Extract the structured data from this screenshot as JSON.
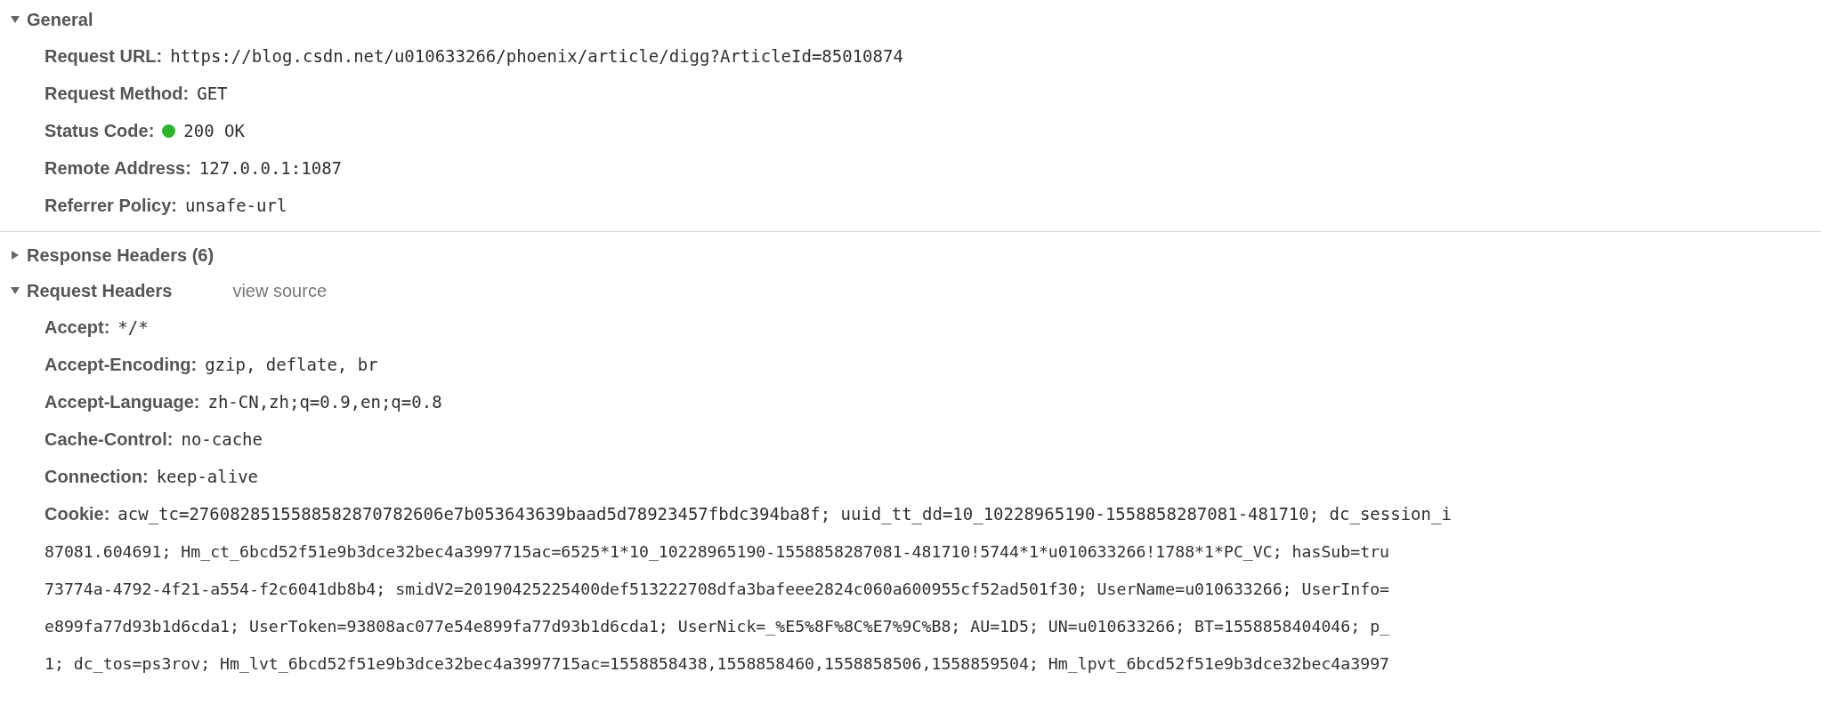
{
  "sections": [
    {
      "title": "General",
      "expanded": true,
      "rows": [
        {
          "name": "Request URL:",
          "value": "https://blog.csdn.net/u010633266/phoenix/article/digg?ArticleId=85010874"
        },
        {
          "name": "Request Method:",
          "value": "GET"
        },
        {
          "name": "Status Code:",
          "value": "200 OK",
          "color": "#2bb52b"
        },
        {
          "name": "Remote Address:",
          "value": "127.0.0.1:1087"
        },
        {
          "name": "Referrer Policy:",
          "value": "unsafe-url"
        }
      ]
    },
    {
      "title": "Response Headers (6)",
      "expanded": false
    },
    {
      "title": "Request Headers",
      "expanded": true,
      "link": "view source",
      "rows": [
        {
          "name": "Accept:",
          "value": "*/*"
        },
        {
          "name": "Accept-Encoding:",
          "value": "gzip, deflate, br"
        },
        {
          "name": "Accept-Language:",
          "value": "zh-CN,zh;q=0.9,en;q=0.8"
        },
        {
          "name": "Cache-Control:",
          "value": "no-cache"
        },
        {
          "name": "Connection:",
          "value": "keep-alive"
        },
        {
          "name": "Cookie:",
          "value": "acw_tc=2760828515588582870782606e7b053643639baad5d78923457fbdc394ba8f; uuid_tt_dd=10_10228965190-1558858287081-481710; dc_session_i",
          "more": [
            "87081.604691; Hm_ct_6bcd52f51e9b3dce32bec4a3997715ac=6525*1*10_10228965190-1558858287081-481710!5744*1*u010633266!1788*1*PC_VC; hasSub=tru",
            "73774a-4792-4f21-a554-f2c6041db8b4; smidV2=20190425225400def513222708dfa3bafeee2824c060a600955cf52ad501f30; UserName=u010633266; UserInfo=",
            "e899fa77d93b1d6cda1; UserToken=93808ac077e54e899fa77d93b1d6cda1; UserNick=_%E5%8F%8C%E7%9C%B8; AU=1D5; UN=u010633266; BT=1558858404046; p_",
            "1; dc_tos=ps3rov; Hm_lvt_6bcd52f51e9b3dce32bec4a3997715ac=1558858438,1558858460,1558858506,1558859504; Hm_lpvt_6bcd52f51e9b3dce32bec4a3997"
          ]
        }
      ]
    }
  ]
}
